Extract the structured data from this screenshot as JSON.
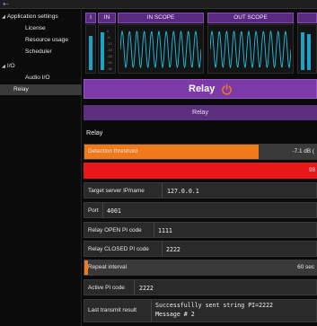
{
  "nav": {
    "back_icon": "back-arrow-icon"
  },
  "sidebar": {
    "items": [
      {
        "label": "Application settings",
        "expanded": true
      },
      {
        "label": "License"
      },
      {
        "label": "Resource usage"
      },
      {
        "label": "Scheduler"
      },
      {
        "label": "I/O",
        "expanded": true
      },
      {
        "label": "Audio I/O"
      },
      {
        "label": "Relay",
        "selected": true
      }
    ]
  },
  "meters": {
    "i_label": "I",
    "in_label": "IN",
    "in_scope_label": "IN SCOPE",
    "out_scope_label": "OUT SCOPE",
    "ticks": [
      "0",
      "-6",
      "-12",
      "-18",
      "-24",
      "-30",
      "-36"
    ]
  },
  "relay": {
    "title": "Relay",
    "power_icon": "power-icon",
    "subbar_label": "Relay",
    "section_label": "Relay"
  },
  "fields": {
    "detection_threshold": {
      "label": "Detection threshold",
      "value": "-7.1 dB (",
      "fraction": 0.75
    },
    "level": {
      "value": "98",
      "fraction": 1.0
    },
    "target_server": {
      "label": "Target server IP/name",
      "value": "127.0.0.1"
    },
    "port": {
      "label": "Port",
      "value": "4001"
    },
    "open_pi": {
      "label": "Relay OPEN PI code",
      "value": "1111"
    },
    "closed_pi": {
      "label": "Relay CLOSED PI code",
      "value": "2222"
    },
    "repeat_interval": {
      "label": "Repeat interval",
      "value": "60 sec",
      "fraction": 0.01
    },
    "active_pi": {
      "label": "Active PI code",
      "value": "2222"
    },
    "last_transmit": {
      "label": "Last transmit result",
      "line1": "Successfullly sent string PI=2222",
      "line2": "Message # 2"
    }
  },
  "colors": {
    "accent": "#7c3aa8",
    "slider": "#f07a1a",
    "level": "#e81818",
    "meter": "#18a4c8"
  }
}
